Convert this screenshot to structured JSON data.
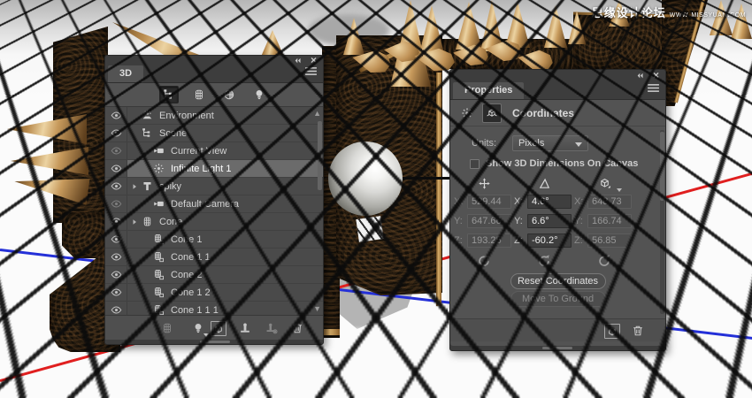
{
  "watermark": {
    "cn": "思缘设计论坛",
    "site": "www.missyuan.com"
  },
  "colors": {
    "panel_bg": "#535353",
    "panel_dark": "#3d3d3d",
    "selected_row": "#6b6b6b",
    "axis_red": "#e01f1f",
    "axis_blue": "#2430d8",
    "spike_gold": "#c79a5c"
  },
  "panel_3d": {
    "tab": "3D",
    "window_controls": [
      "collapse-panels-icon",
      "close-icon"
    ],
    "menu_icon": "panel-menu-icon",
    "filter_icons": [
      {
        "name": "filter-scene-icon",
        "active": true
      },
      {
        "name": "filter-mesh-icon",
        "active": false
      },
      {
        "name": "filter-materials-icon",
        "active": false
      },
      {
        "name": "filter-lights-icon",
        "active": false
      }
    ],
    "rows": [
      {
        "label": "Environment",
        "icon": "environment-icon",
        "indent": 0
      },
      {
        "label": "Scene",
        "icon": "scene-icon",
        "indent": 0
      },
      {
        "label": "Current View",
        "icon": "camera-icon",
        "indent": 1,
        "eye_dim": true
      },
      {
        "label": "Infinite Light 1",
        "icon": "infinite-light-icon",
        "indent": 1,
        "selected": true
      },
      {
        "label": "spiky",
        "icon": "mesh-t-icon",
        "indent": 0,
        "expander": true
      },
      {
        "label": "Default Camera",
        "icon": "camera-icon",
        "indent": 1,
        "eye_dim": true
      },
      {
        "label": "Cone",
        "icon": "mesh-icon",
        "indent": 0,
        "expander": true
      },
      {
        "label": "Cone 1",
        "icon": "mesh-instance-icon",
        "indent": 1
      },
      {
        "label": "Cone 1 1",
        "icon": "mesh-instance-icon",
        "indent": 1
      },
      {
        "label": "Cone 2",
        "icon": "mesh-instance-icon",
        "indent": 1
      },
      {
        "label": "Cone 1 2",
        "icon": "mesh-instance-icon",
        "indent": 1
      },
      {
        "label": "Cone 1 1 1",
        "icon": "mesh-instance-icon",
        "indent": 1
      }
    ],
    "footer_icons": [
      {
        "name": "mesh-icon",
        "dim": true
      },
      {
        "name": "lightbulb-icon",
        "caret": true
      },
      {
        "name": "add-cube-icon",
        "boxed": true
      },
      {
        "name": "stamp-icon"
      },
      {
        "name": "stamp-delete-icon",
        "dim": true
      },
      {
        "name": "trash-icon"
      }
    ]
  },
  "properties": {
    "tab": "Properties",
    "window_controls": [
      "collapse-panels-icon",
      "close-icon"
    ],
    "menu_icon": "panel-menu-icon",
    "header": {
      "title": "Coordinates",
      "icons": [
        "infinite-light-icon",
        "coordinates-icon"
      ]
    },
    "units": {
      "label": "Units:",
      "value": "Pixels"
    },
    "checkbox": {
      "label": "Show 3D Dimensions On Canvas",
      "checked": false
    },
    "coordinates": {
      "columns": [
        {
          "name": "position",
          "icon": "move-icon",
          "disabled": true,
          "rows": [
            {
              "axis": "X:",
              "value": "529.44"
            },
            {
              "axis": "Y:",
              "value": "647.66"
            },
            {
              "axis": "Z:",
              "value": "193.25"
            }
          ]
        },
        {
          "name": "rotation",
          "icon": "rotate-icon",
          "disabled": false,
          "rows": [
            {
              "axis": "X:",
              "value": "4.6°"
            },
            {
              "axis": "Y:",
              "value": "6.6°"
            },
            {
              "axis": "Z:",
              "value": "-60.2°"
            }
          ]
        },
        {
          "name": "scale",
          "icon": "scale-icon",
          "disabled": true,
          "caret": true,
          "rows": [
            {
              "axis": "X:",
              "value": "648.73"
            },
            {
              "axis": "Y:",
              "value": "166.74"
            },
            {
              "axis": "Z:",
              "value": "56.85"
            }
          ]
        }
      ],
      "reset_icon": "reset-icon"
    },
    "buttons": [
      {
        "label": "Reset Coordinates",
        "disabled": false
      },
      {
        "label": "Move To Ground",
        "disabled": true
      }
    ],
    "footer_icons": [
      {
        "name": "add-cube-icon",
        "boxed": true
      },
      {
        "name": "trash-icon"
      }
    ]
  }
}
